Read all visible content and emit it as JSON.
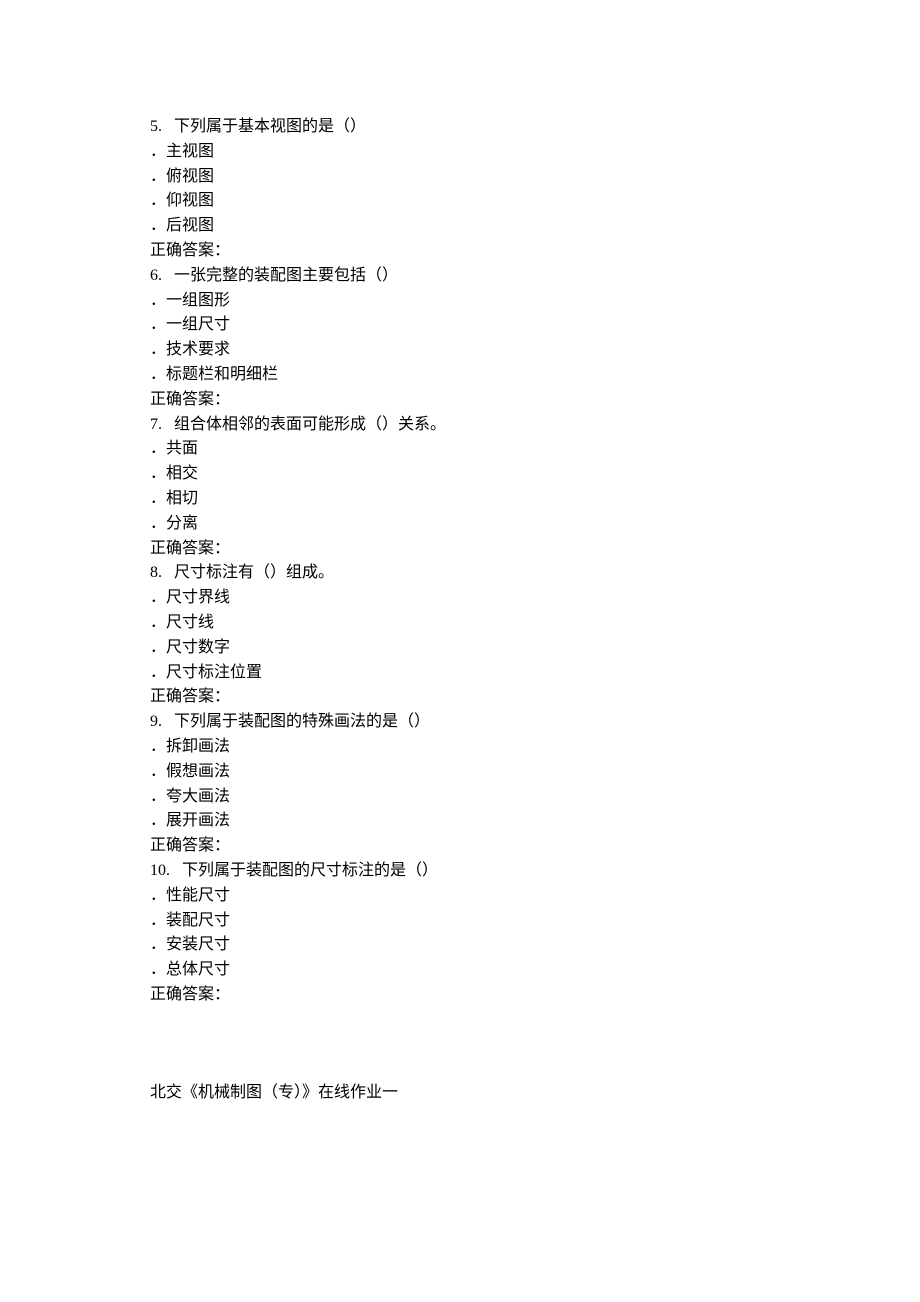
{
  "questions": [
    {
      "num": "5.",
      "text": "下列属于基本视图的是（）",
      "options": [
        "主视图",
        "俯视图",
        "仰视图",
        "后视图"
      ],
      "answer_label": "正确答案："
    },
    {
      "num": "6.",
      "text": "一张完整的装配图主要包括（）",
      "options": [
        "一组图形",
        "一组尺寸",
        "技术要求",
        "标题栏和明细栏"
      ],
      "answer_label": "正确答案："
    },
    {
      "num": "7.",
      "text": "组合体相邻的表面可能形成（）关系。",
      "options": [
        "共面",
        "相交",
        "相切",
        "分离"
      ],
      "answer_label": "正确答案："
    },
    {
      "num": "8.",
      "text": "尺寸标注有（）组成。",
      "options": [
        "尺寸界线",
        "尺寸线",
        "尺寸数字",
        "尺寸标注位置"
      ],
      "answer_label": "正确答案："
    },
    {
      "num": "9.",
      "text": "下列属于装配图的特殊画法的是（）",
      "options": [
        "拆卸画法",
        "假想画法",
        "夸大画法",
        "展开画法"
      ],
      "answer_label": "正确答案："
    },
    {
      "num": "10.",
      "text": "下列属于装配图的尺寸标注的是（）",
      "options": [
        "性能尺寸",
        "装配尺寸",
        "安装尺寸",
        "总体尺寸"
      ],
      "answer_label": "正确答案："
    }
  ],
  "footer": "北交《机械制图（专）》在线作业一"
}
